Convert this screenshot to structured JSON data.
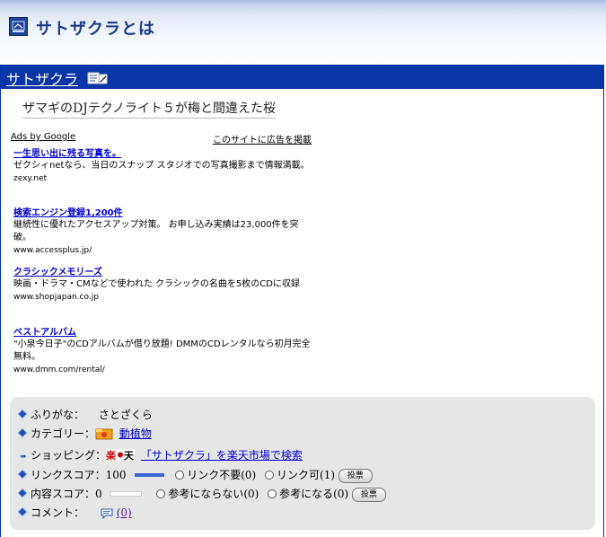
{
  "header": {
    "title": "サトザクラとは"
  },
  "panel": {
    "title": "サトザクラ",
    "subtitle": "ザマギのDJテクノライト５が梅と間違えた桜"
  },
  "ads": {
    "ads_by": "Ads by Google",
    "place_ad": "このサイトに広告を掲載",
    "items": [
      {
        "title": "一生思い出に残る写真を。",
        "desc": "ゼクシィnetなら、当日のスナップ スタジオでの写真撮影まで情報満載。",
        "url": "zexy.net"
      },
      {
        "title": "検索エンジン登録1,200件",
        "desc": "継続性に優れたアクセスアップ対策。 お申し込み実績は23,000件を突破。",
        "url": "www.accessplus.jp/"
      },
      {
        "title": "クラシックメモリーズ",
        "desc": "映画・ドラマ・CMなどで使われた クラシックの名曲を5枚のCDに収録",
        "url": "www.shopjapan.co.jp"
      },
      {
        "title": "ベストアルバム",
        "desc": "\"小泉今日子\"のCDアルバムが借り放題! DMMのCDレンタルなら初月完全無料。",
        "url": "www.dmm.com/rental/"
      }
    ]
  },
  "info": {
    "furigana_label": "ふりがな：",
    "furigana_value": "さとざくら",
    "category_label": "カテゴリー：",
    "category_value": "動植物",
    "shopping_label": "ショッピング：",
    "shopping_link": "「サトザクラ」を楽天市場で検索",
    "link_score_label": "リンクスコア：",
    "link_score_value": "100",
    "link_score_fill": 1.0,
    "link_unneeded": "リンク不要(0)",
    "link_ok": "リンク可(1)",
    "vote_label": "投票",
    "content_score_label": "内容スコア：",
    "content_score_value": "0",
    "content_score_fill": 0.0,
    "not_useful": "参考にならない(0)",
    "useful": "参考になる(0)",
    "vote_label2": "投票",
    "comment_label": "コメント：",
    "comment_count": "(0)"
  },
  "colors": {
    "panel_bar": "#0a35a6",
    "link": "#0000cc",
    "score_bar": "#3a66d8"
  },
  "icons": [
    "dictionary-logo-icon",
    "edit-icon",
    "category-icon",
    "rakuten-icon",
    "comment-icon",
    "bullet-icon",
    "arrow-bullet-icon"
  ]
}
